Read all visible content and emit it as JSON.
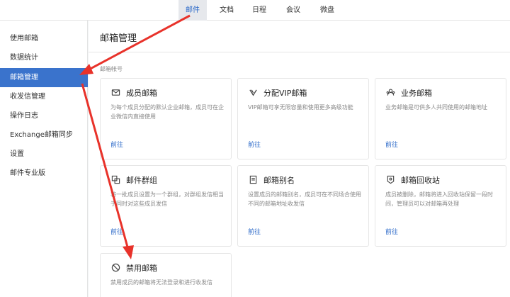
{
  "topnav": {
    "tabs": [
      {
        "label": "邮件",
        "active": true
      },
      {
        "label": "文档",
        "active": false
      },
      {
        "label": "日程",
        "active": false
      },
      {
        "label": "会议",
        "active": false
      },
      {
        "label": "微盘",
        "active": false
      }
    ]
  },
  "sidebar": {
    "items": [
      {
        "label": "使用邮箱"
      },
      {
        "label": "数据统计"
      },
      {
        "label": "邮箱管理",
        "active": true
      },
      {
        "label": "收发信管理"
      },
      {
        "label": "操作日志"
      },
      {
        "label": "Exchange邮箱同步"
      },
      {
        "label": "设置"
      },
      {
        "label": "邮件专业版"
      }
    ]
  },
  "main": {
    "title": "邮箱管理",
    "section_label": "邮箱帐号",
    "cards": [
      {
        "icon": "envelope-icon",
        "title": "成员邮箱",
        "desc": "为每个成员分配的默认企业邮箱，成员可在企业微信内直接使用",
        "link": "前往"
      },
      {
        "icon": "vip-icon",
        "title": "分配VIP邮箱",
        "desc": "VIP邮箱可享无限容量和使用更多高级功能",
        "link": "前往"
      },
      {
        "icon": "group-icon",
        "title": "业务邮箱",
        "desc": "业务邮箱是可供多人共同使用的邮箱地址",
        "link": "前往"
      },
      {
        "icon": "mail-group-icon",
        "title": "邮件群组",
        "desc": "将一批成员设置为一个群组，对群组发信相当于同时对这些成员发信",
        "link": "前往"
      },
      {
        "icon": "alias-icon",
        "title": "邮箱别名",
        "desc": "设置成员的邮箱别名，成员可在不同场合使用不同的邮箱地址收发信",
        "link": "前往"
      },
      {
        "icon": "recycle-bin-icon",
        "title": "邮箱回收站",
        "desc": "成员被删除，邮箱将进入回收站保留一段时间，管理员可以对邮箱再处理",
        "link": "前往"
      },
      {
        "icon": "disable-icon",
        "title": "禁用邮箱",
        "desc": "禁用成员的邮箱将无法登录和进行收发信",
        "link": ""
      }
    ]
  },
  "colors": {
    "accent": "#3a73cc",
    "link": "#2a68c8",
    "annotation_arrow": "#e8322a"
  }
}
